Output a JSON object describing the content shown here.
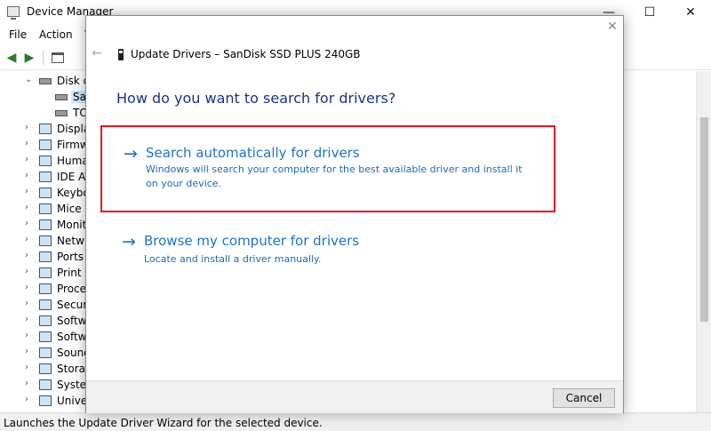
{
  "window": {
    "title": "Device Manager",
    "minimize_glyph": "—",
    "maximize_glyph": "☐",
    "close_glyph": "✕"
  },
  "menu": {
    "file": "File",
    "action": "Action",
    "view": "V"
  },
  "toolbar": {
    "back_icon": "back-arrow-icon",
    "forward_icon": "forward-arrow-icon"
  },
  "tree": {
    "disk_drives": {
      "label": "Disk d",
      "expanded": true
    },
    "disk_children": [
      {
        "label": "Sa",
        "selected": true
      },
      {
        "label": "TO",
        "selected": false
      }
    ],
    "categories": [
      "Displa",
      "Firmw",
      "Huma",
      "IDE AT",
      "Keybo",
      "Mice a",
      "Monit",
      "Netw",
      "Ports (",
      "Print q",
      "Proces",
      "Securi",
      "Softw",
      "Softw",
      "Sound",
      "Storag",
      "Syster",
      "Univer"
    ]
  },
  "status_bar": {
    "text": "Launches the Update Driver Wizard for the selected device."
  },
  "wizard": {
    "close_glyph": "✕",
    "back_glyph": "←",
    "title": "Update Drivers – SanDisk SSD PLUS 240GB",
    "heading": "How do you want to search for drivers?",
    "option_arrow": "→",
    "auto": {
      "title": "Search automatically for drivers",
      "description": "Windows will search your computer for the best available driver and install it on your device."
    },
    "browse": {
      "title": "Browse my computer for drivers",
      "description": "Locate and install a driver manually."
    },
    "cancel_label": "Cancel",
    "highlight_color": "#e81123",
    "link_color": "#1e73c8"
  }
}
